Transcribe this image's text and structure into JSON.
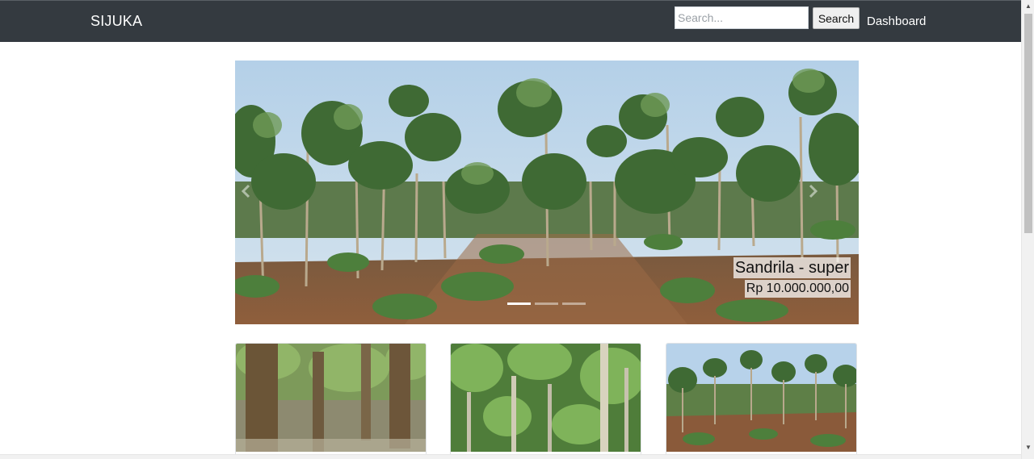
{
  "navbar": {
    "brand": "SIJUKA",
    "search_placeholder": "Search...",
    "search_value": "",
    "search_button": "Search",
    "dashboard_link": "Dashboard",
    "background": "#343a40"
  },
  "carousel": {
    "active_slide": 1,
    "slides_count": 3,
    "caption": {
      "title": "Sandrila - super",
      "price": "Rp 10.000.000,00"
    },
    "next_icon": "chevron-right-icon",
    "prev_icon": "chevron-left-icon"
  },
  "cards": [
    {
      "image": "teak-forest-trunks"
    },
    {
      "image": "teak-forest-green-canopy"
    },
    {
      "image": "teak-plantation-rows"
    }
  ]
}
